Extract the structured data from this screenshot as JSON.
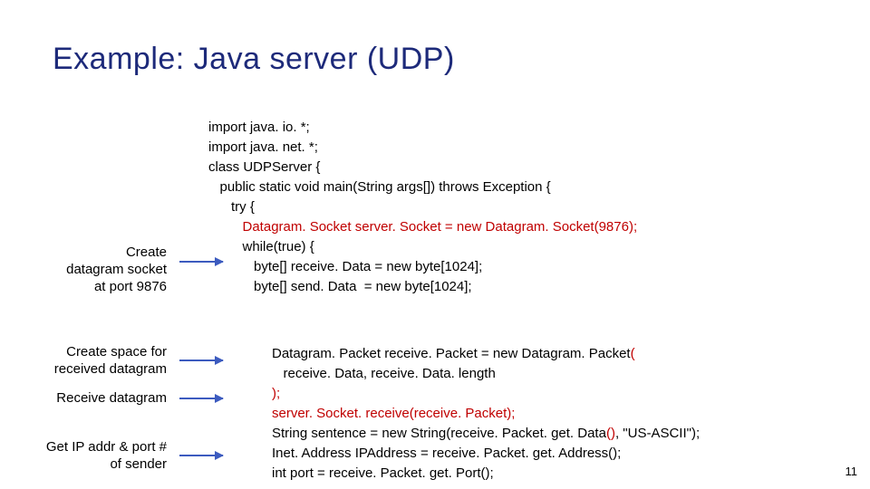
{
  "title": "Example: Java server (UDP)",
  "annotations": {
    "a1_l1": "Create",
    "a1_l2": "datagram socket",
    "a1_l3": "at port 9876",
    "a2_l1": "Create space for",
    "a2_l2": "received datagram",
    "a3_l1": "Receive datagram",
    "a4_l1": "Get IP addr & port #",
    "a4_l2": "of sender"
  },
  "code": {
    "l1": "import java. io. *;",
    "l2": "import java. net. *;",
    "l3": "class UDPServer {",
    "l4": "   public static void main(String args[]) throws Exception {",
    "l5": "      try {",
    "l6_red": "         Datagram. Socket server. Socket = new Datagram. Socket(9876);",
    "l7": "         while(true) {",
    "l8": "            byte[] receive. Data = new byte[1024];",
    "l9": "            byte[] send. Data  = new byte[1024];",
    "b2_l1_a": "Datagram. Packet receive. Packet = new Datagram. Packet",
    "b2_l1_red": "(",
    "b2_l2": "   receive. Data, receive. Data. length",
    "b2_l3_red": ");",
    "b2_l4_red": "server. Socket. receive(receive. Packet);",
    "b2_l5_a": "String sentence = new String(receive. Packet. get. Data",
    "b2_l5_red": "()",
    "b2_l5_c": ", \"US-ASCII\");",
    "b3_l1_a": "Inet. Address IPAddress = receive. Packet. get. Address",
    "b3_l1_red": "();",
    "b3_l2_a": "int port = receive. Packet. get. Port",
    "b3_l2_red": "();"
  },
  "page_number": "11"
}
